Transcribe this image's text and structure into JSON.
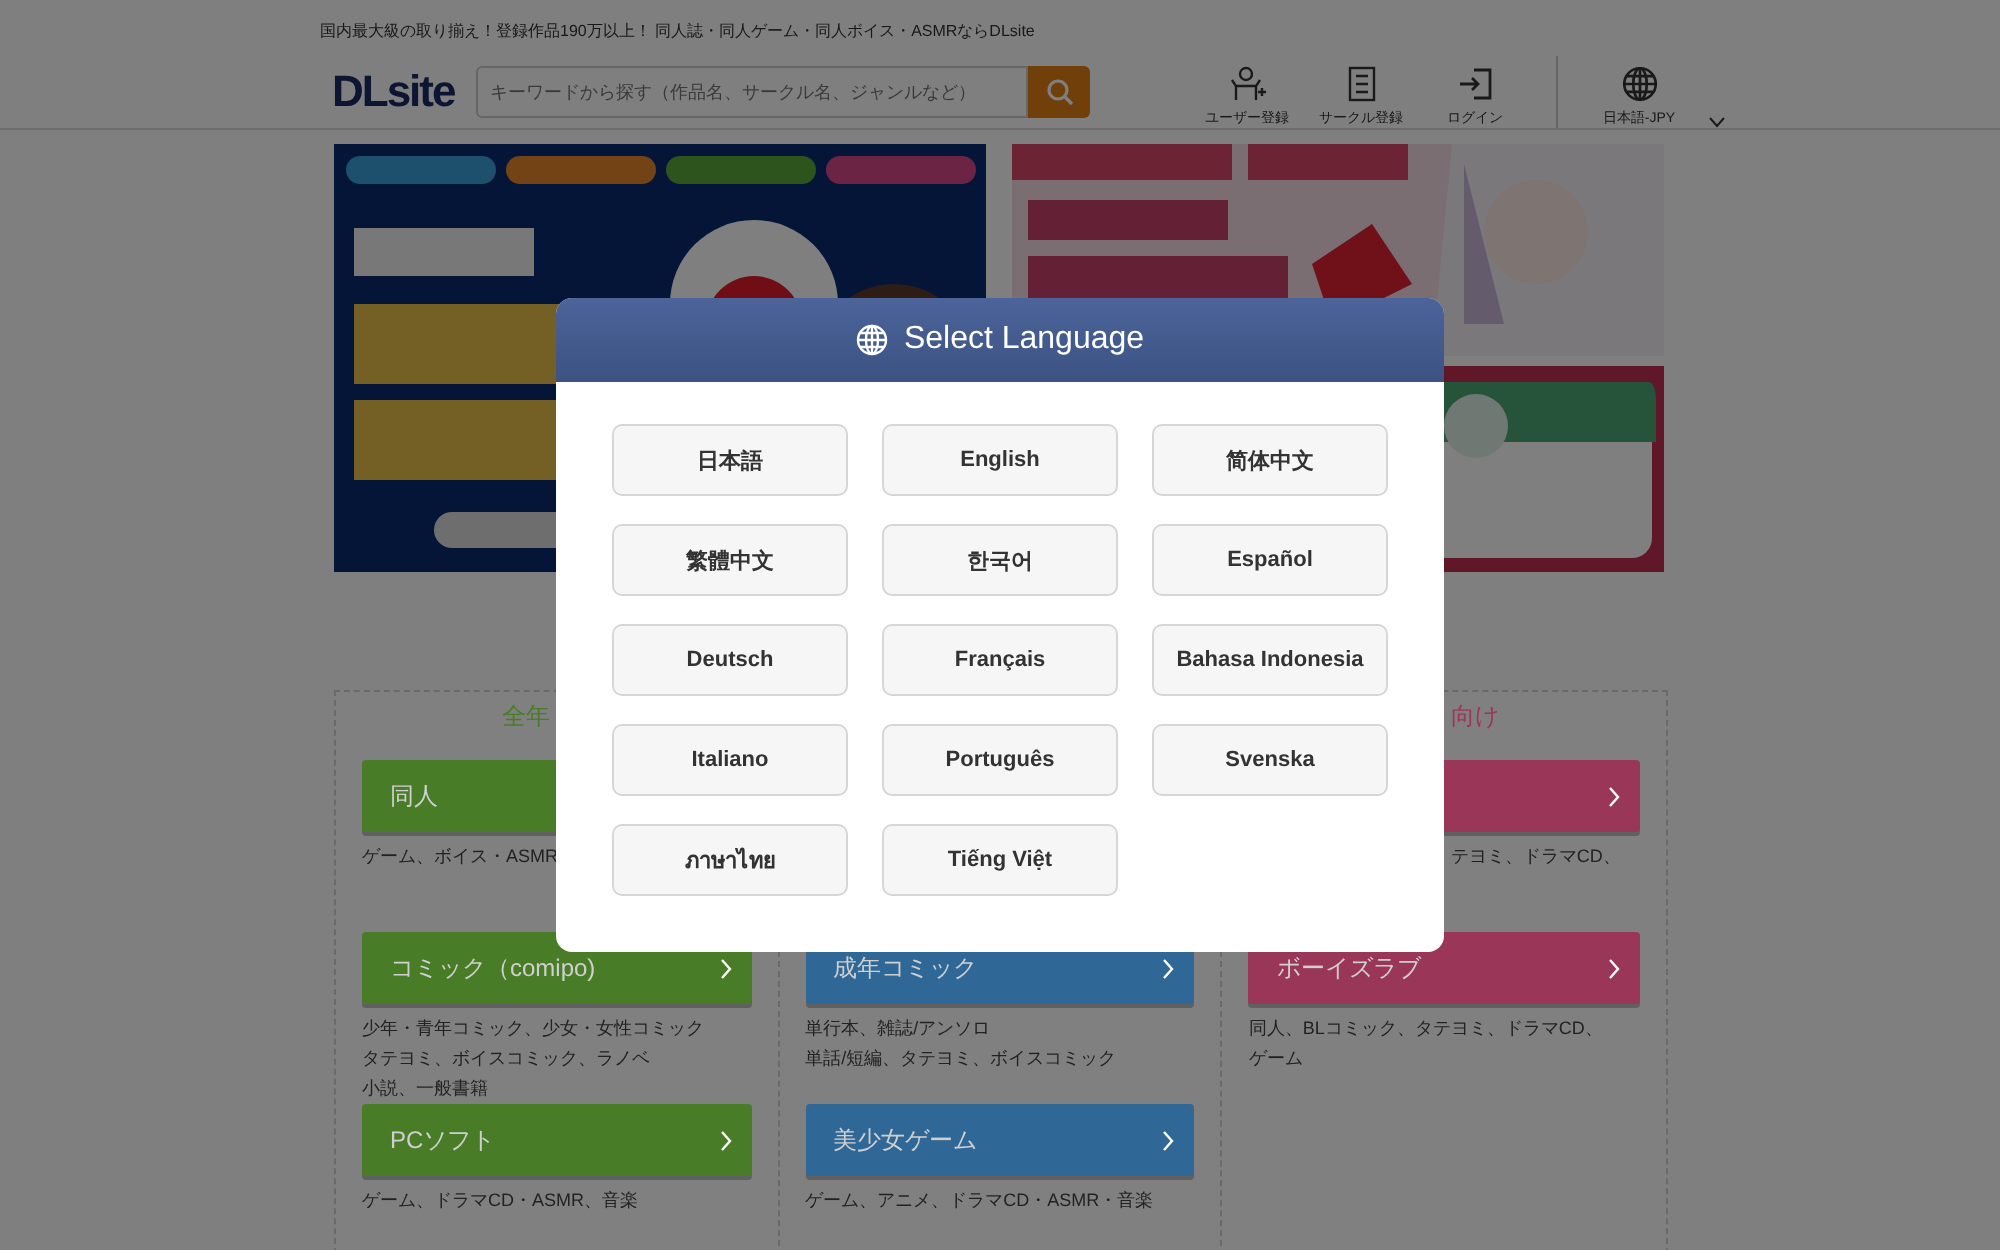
{
  "header": {
    "tagline": "国内最大級の取り揃え！登録作品190万以上！ 同人誌・同人ゲーム・同人ボイス・ASMRならDLsite",
    "logo": "DLsite",
    "search": {
      "placeholder": "キーワードから探す（作品名、サークル名、ジャンルなど）"
    },
    "nav": [
      {
        "kind": "user",
        "label": "ユーザー登録"
      },
      {
        "kind": "circle",
        "label": "サークル登録"
      },
      {
        "kind": "login",
        "label": "ログイン"
      }
    ],
    "locale": "日本語-JPY"
  },
  "categories": [
    {
      "heading": "全年",
      "color": "#497c27",
      "items": [
        {
          "label": "同人",
          "description": [
            "ゲーム、ボイス・ASMR"
          ]
        },
        {
          "label": "コミック（comipo)",
          "description": [
            "少年・青年コミック、少女・女性コミック",
            "タテヨミ、ボイスコミック、ラノベ",
            "小説、一般書籍"
          ]
        },
        {
          "label": "PCソフト",
          "description": [
            "ゲーム、ドラマCD・ASMR、音楽"
          ]
        }
      ]
    },
    {
      "color": "#2f6896",
      "items": [
        {
          "label": "成年コミック",
          "description": [
            "単行本、雑誌/アンソロ",
            "単話/短編、タテヨミ、ボイスコミック"
          ]
        },
        {
          "label": "美少女ゲーム",
          "description": [
            "ゲーム、アニメ、ドラマCD・ASMR・音楽"
          ]
        }
      ]
    },
    {
      "heading": "向け",
      "color": "#9a3658",
      "items": [
        {
          "description": [
            "テヨミ、ドラマCD、"
          ]
        },
        {
          "label": "ボーイズラブ",
          "description": [
            "同人、BLコミック、タテヨミ、ドラマCD、",
            "ゲーム"
          ]
        }
      ]
    }
  ],
  "modal": {
    "title": "Select Language",
    "languages": [
      "日本語",
      "English",
      "简体中文",
      "繁體中文",
      "한국어",
      "Español",
      "Deutsch",
      "Français",
      "Bahasa Indonesia",
      "Italiano",
      "Português",
      "Svenska",
      "ภาษาไทย",
      "Tiếng Việt"
    ]
  }
}
